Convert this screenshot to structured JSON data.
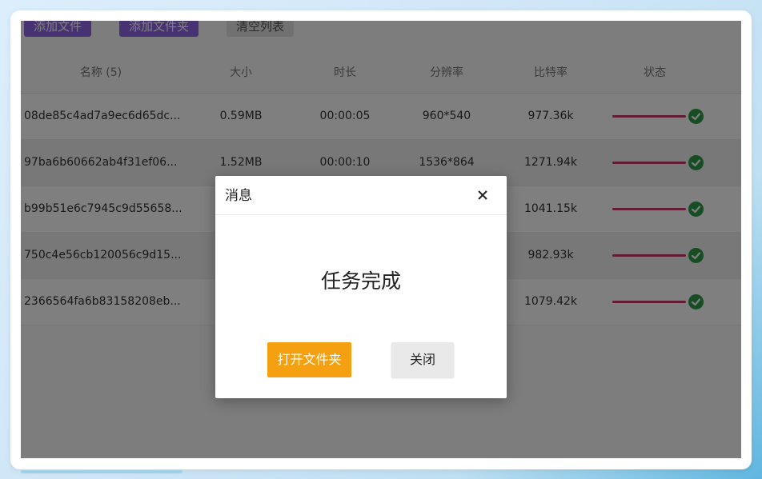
{
  "toolbar": {
    "add_file_label": "添加文件",
    "add_folder_label": "添加文件夹",
    "clear_list_label": "清空列表"
  },
  "table": {
    "headers": {
      "name": "名称 (5)",
      "size": "大小",
      "duration": "时长",
      "resolution": "分辨率",
      "bitrate": "比特率",
      "status": "状态"
    },
    "rows": [
      {
        "name": "08de85c4ad7a9ec6d65dc...",
        "size": "0.59MB",
        "duration": "00:00:05",
        "resolution": "960*540",
        "bitrate": "977.36k",
        "progress": 1.0
      },
      {
        "name": "97ba6b60662ab4f31ef06...",
        "size": "1.52MB",
        "duration": "00:00:10",
        "resolution": "1536*864",
        "bitrate": "1271.94k",
        "progress": 1.0
      },
      {
        "name": "b99b51e6c7945c9d55658...",
        "size": "",
        "duration": "",
        "resolution": "",
        "bitrate": "1041.15k",
        "progress": 1.0
      },
      {
        "name": "750c4e56cb120056c9d15...",
        "size": "",
        "duration": "",
        "resolution": "",
        "bitrate": "982.93k",
        "progress": 1.0
      },
      {
        "name": "2366564fa6b83158208eb...",
        "size": "",
        "duration": "",
        "resolution": "",
        "bitrate": "1079.42k",
        "progress": 1.0
      }
    ]
  },
  "dialog": {
    "title": "消息",
    "message": "任务完成",
    "open_folder_label": "打开文件夹",
    "close_label": "关闭"
  },
  "colors": {
    "toolbar_button": "#8e65e6",
    "progress": "#c43a6a",
    "status_ok": "#2e9b4a",
    "primary_button": "#f5a011"
  },
  "icons": {
    "status": "check-circle-icon",
    "close": "close-icon"
  }
}
